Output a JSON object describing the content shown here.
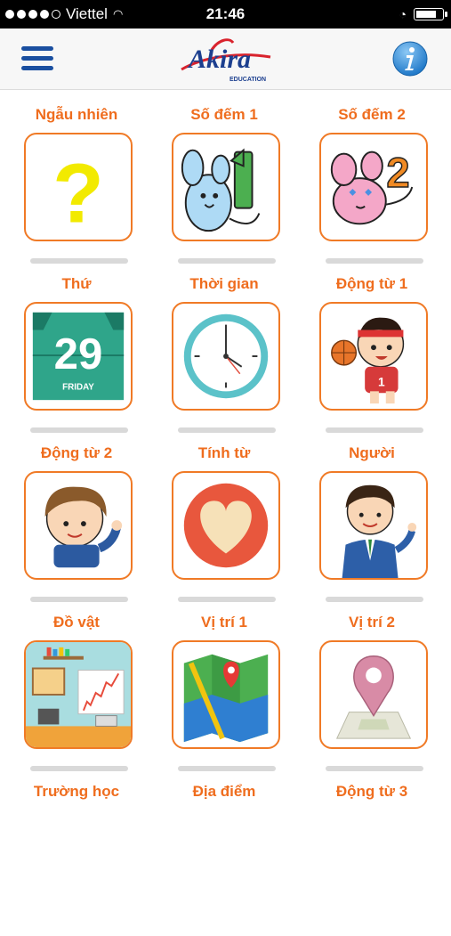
{
  "status_bar": {
    "carrier": "Viettel",
    "time": "21:46"
  },
  "header": {
    "menu_icon": "hamburger-menu-icon",
    "logo_text": "Akira",
    "logo_subtext": "EDUCATION",
    "info_icon": "info-icon"
  },
  "categories": [
    {
      "label": "Ngẫu nhiên",
      "icon": "question-mark-icon"
    },
    {
      "label": "Số đếm 1",
      "icon": "mouse-number-one-icon"
    },
    {
      "label": "Số đếm 2",
      "icon": "mouse-number-two-icon"
    },
    {
      "label": "Thứ",
      "icon": "calendar-icon",
      "calendar_day": "29",
      "calendar_weekday": "FRIDAY"
    },
    {
      "label": "Thời gian",
      "icon": "clock-icon"
    },
    {
      "label": "Động từ 1",
      "icon": "basketball-boy-icon"
    },
    {
      "label": "Động từ 2",
      "icon": "waving-boy-icon"
    },
    {
      "label": "Tính từ",
      "icon": "heart-icon"
    },
    {
      "label": "Người",
      "icon": "businessman-icon"
    },
    {
      "label": "Đồ vật",
      "icon": "office-room-icon"
    },
    {
      "label": "Vị trí 1",
      "icon": "map-icon"
    },
    {
      "label": "Vị trí 2",
      "icon": "location-pin-icon"
    },
    {
      "label": "Trường học",
      "icon": ""
    },
    {
      "label": "Địa điểm",
      "icon": ""
    },
    {
      "label": "Động từ 3",
      "icon": ""
    }
  ],
  "colors": {
    "accent": "#ef6d1e",
    "tile_border": "#f07a26",
    "menu_blue": "#1a4fa0",
    "info_blue": "#2a8ad8"
  }
}
